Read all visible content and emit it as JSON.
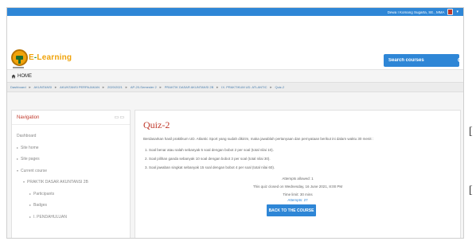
{
  "user": {
    "name": "Dewa I Komang Sugarta, SE., MMA"
  },
  "header": {
    "logo_text_pre": "E",
    "logo_text_hl": "-",
    "logo_text_post": "Learning"
  },
  "search": {
    "placeholder": "Search courses"
  },
  "home": {
    "label": "HOME"
  },
  "breadcrumb": [
    "Dashboard",
    "AKUNTANSI",
    "AKUNTANSI PERPAJAKAN",
    "2020/2021",
    "AP-20-Semester 2",
    "PRAKTIK DASAR AKUNTANSI 2B",
    "IX. PRAKTIKUM UD. ATLANTIC",
    "Quiz-2"
  ],
  "navigation": {
    "title": "Navigation",
    "items": [
      {
        "label": "Dashboard",
        "arrow": ""
      },
      {
        "label": "Site home",
        "arrow": "▸"
      },
      {
        "label": "Site pages",
        "arrow": "▸"
      },
      {
        "label": "Current course",
        "arrow": "▾"
      },
      {
        "label": "PRAKTIK DASAR AKUNTANSI 2B",
        "arrow": "▾"
      },
      {
        "label": "Participants",
        "arrow": "▸"
      },
      {
        "label": "Badges",
        "arrow": "▸"
      },
      {
        "label": "I. PENDAHULUAN",
        "arrow": "▸"
      }
    ]
  },
  "quiz": {
    "title": "Quiz-2",
    "intro": "Berdasarkan hasil praktikum UD. Atlantic Sport yang sudah dikirim, maka jawablah pertanyaan dan pernyataan berikut ini dalam waktu 30 menit :",
    "rules": [
      "1. Soal benar atau salah sebanyak 5 soal dengan bobot 2 per soal (total nilai 10).",
      "2. Soal pilihan ganda sebanyak 10 soal dengan bobot 3 per soal (total nilai 30).",
      "3. Soal jawaban singkat sebanyak 15 soal dengan bobot 4 per soal (total nilai 60)."
    ],
    "attempts_allowed": "Attempts allowed: 1",
    "closed_info": "This quiz closed on Wednesday, 16 June 2021, 8:00 PM",
    "time_limit": "Time limit: 30 mins",
    "attempts_link": "Attempts: 27",
    "back_button": "BACK TO THE COURSE"
  },
  "side_marks": {
    "mark1": "[",
    "mark2": "["
  },
  "colors": {
    "accent": "#2e86d6",
    "title_red": "#c0392b",
    "logo_orange": "#f0a30a",
    "logo_green": "#2e9c3a"
  }
}
